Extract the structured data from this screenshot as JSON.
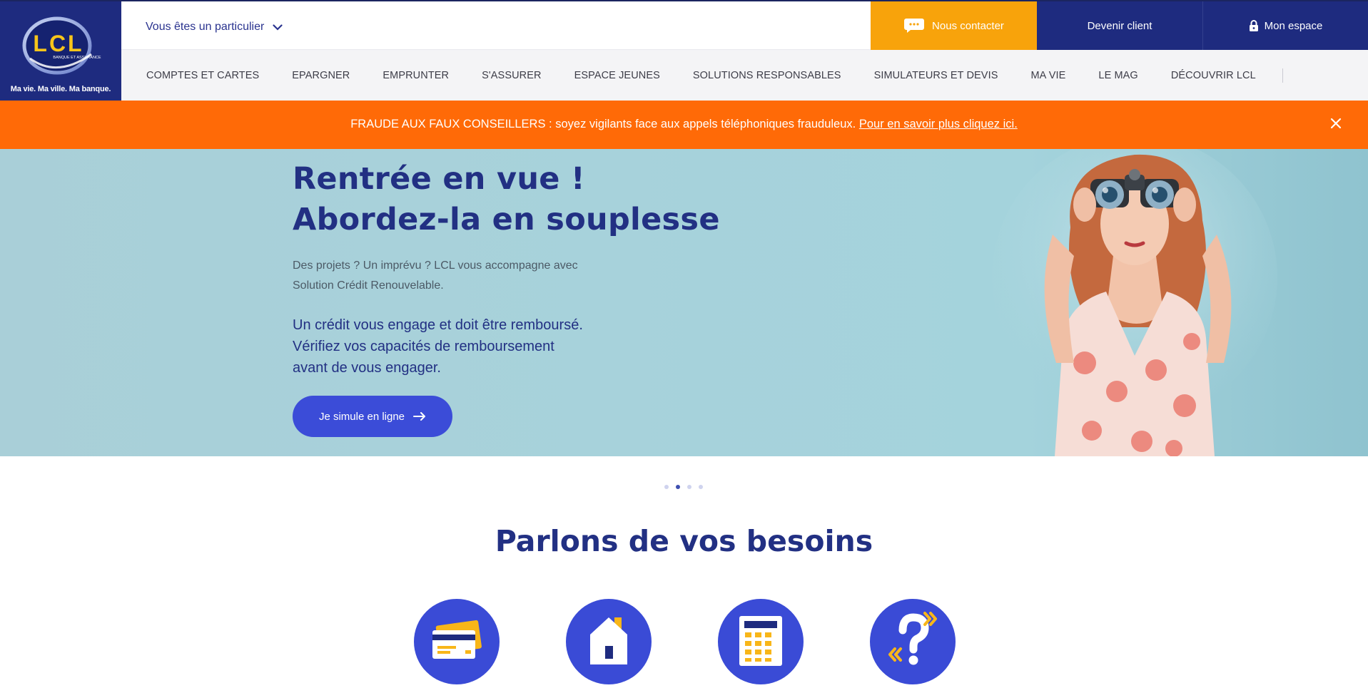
{
  "brand": {
    "logo_text": "LCL",
    "logo_subtext": "BANQUE ET ASSURANCE",
    "tagline": "Ma vie. Ma ville. Ma banque."
  },
  "header": {
    "profile_select": "Vous êtes un particulier",
    "contact_label": "Nous contacter",
    "client_label": "Devenir client",
    "space_label": "Mon espace"
  },
  "nav": {
    "items": [
      "COMPTES ET CARTES",
      "EPARGNER",
      "EMPRUNTER",
      "S'ASSURER",
      "ESPACE JEUNES",
      "SOLUTIONS RESPONSABLES",
      "SIMULATEURS ET DEVIS",
      "MA VIE",
      "LE MAG",
      "DÉCOUVRIR LCL"
    ]
  },
  "alert": {
    "text": "FRAUDE AUX FAUX CONSEILLERS : soyez vigilants face aux appels téléphoniques frauduleux.",
    "link": "Pour en savoir plus cliquez ici."
  },
  "hero": {
    "title_line1": "Rentrée en vue !",
    "title_line2": "Abordez-la en souplesse",
    "desc_line1": "Des projets ? Un imprévu ? LCL vous accompagne avec",
    "desc_line2": "Solution Crédit Renouvelable.",
    "legal_line1": "Un crédit vous engage et doit être remboursé.",
    "legal_line2": "Vérifiez vos capacités de remboursement",
    "legal_line3": "avant de vous engager.",
    "cta_label": "Je simule en ligne"
  },
  "carousel": {
    "slides": 4,
    "active_index": 1
  },
  "needs": {
    "title": "Parlons de vos besoins",
    "icons": [
      "bank-card-icon",
      "house-icon",
      "calculator-icon",
      "question-icon"
    ]
  },
  "colors": {
    "brand_blue": "#1e2b7f",
    "accent_orange": "#f8a30b",
    "alert_orange": "#ff6a07",
    "cta_blue": "#3b4cd8"
  }
}
